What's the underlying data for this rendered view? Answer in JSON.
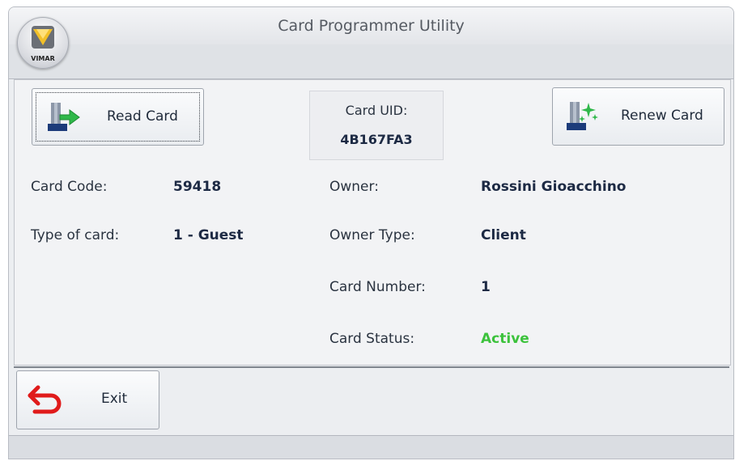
{
  "window": {
    "title": "Card Programmer Utility"
  },
  "app_menu": {
    "logo_text": "VIMAR"
  },
  "toolbar": {
    "read_card_label": "Read Card",
    "renew_card_label": "Renew Card",
    "exit_label": "Exit"
  },
  "card_uid": {
    "label": "Card UID:",
    "value": "4B167FA3"
  },
  "fields": {
    "card_code": {
      "label": "Card Code:",
      "value": "59418"
    },
    "type_of_card": {
      "label": "Type of card:",
      "value": "1 - Guest"
    },
    "owner": {
      "label": "Owner:",
      "value": "Rossini Gioacchino"
    },
    "owner_type": {
      "label": "Owner Type:",
      "value": "Client"
    },
    "card_number": {
      "label": "Card Number:",
      "value": "1"
    },
    "card_status": {
      "label": "Card Status:",
      "value": "Active"
    }
  },
  "colors": {
    "active_status": "#3cc23c",
    "exit_icon": "#e01b1b",
    "read_arrow": "#2fb84a"
  },
  "icons": [
    "vimar-logo-icon",
    "read-card-icon",
    "renew-card-icon",
    "exit-arrow-icon"
  ]
}
